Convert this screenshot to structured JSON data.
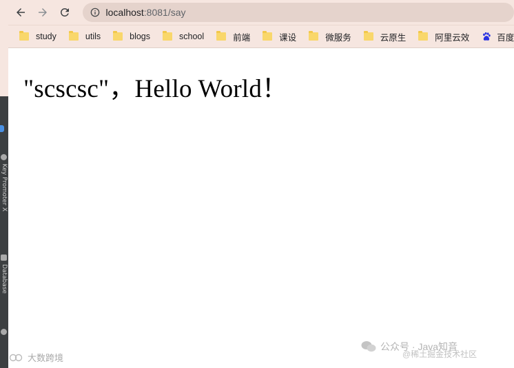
{
  "browser": {
    "url_host": "localhost",
    "url_path": ":8081/say"
  },
  "bookmarks": [
    {
      "label": "study",
      "icon": "folder-icon"
    },
    {
      "label": "utils",
      "icon": "folder-icon"
    },
    {
      "label": "blogs",
      "icon": "folder-icon"
    },
    {
      "label": "school",
      "icon": "folder-icon"
    },
    {
      "label": "前端",
      "icon": "folder-icon"
    },
    {
      "label": "课设",
      "icon": "folder-icon"
    },
    {
      "label": "微服务",
      "icon": "folder-icon"
    },
    {
      "label": "云原生",
      "icon": "folder-icon"
    },
    {
      "label": "阿里云效",
      "icon": "folder-icon"
    },
    {
      "label": "百度",
      "icon": "baidu-paw-icon"
    }
  ],
  "page": {
    "greeting": "\"scscsc\"，Hello World！"
  },
  "watermarks": {
    "left": "大数跨境",
    "right_main": "公众号 · Java知音",
    "right_sub": "@稀土掘金技术社区"
  },
  "colors": {
    "toolbar_bg": "#f6e6e0",
    "omnibox_bg": "#e5d3cc",
    "folder": "#f9d76b",
    "ide_strip": "#3c3f41"
  }
}
